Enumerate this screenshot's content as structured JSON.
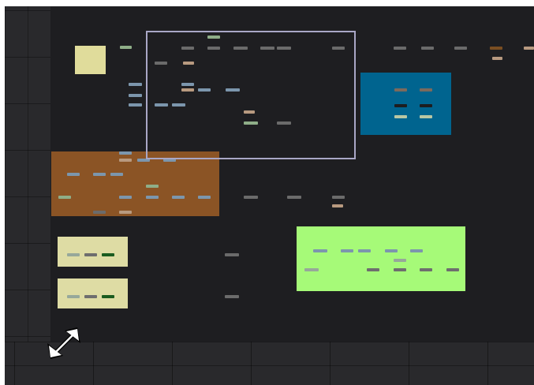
{
  "minimap": {
    "frames": [
      {
        "name": "khaki-square",
        "color": "#e0dc9b"
      },
      {
        "name": "blue-frame",
        "color": "#00648f"
      },
      {
        "name": "orange-frame",
        "color": "#8b5425"
      },
      {
        "name": "khaki-frame-1",
        "color": "#dedca4"
      },
      {
        "name": "khaki-frame-2",
        "color": "#dedca4"
      },
      {
        "name": "green-frame",
        "color": "#a6fa78"
      }
    ],
    "viewport_color": "#a9a7c6",
    "resize_icon": "diagonal-resize-arrow-icon"
  }
}
